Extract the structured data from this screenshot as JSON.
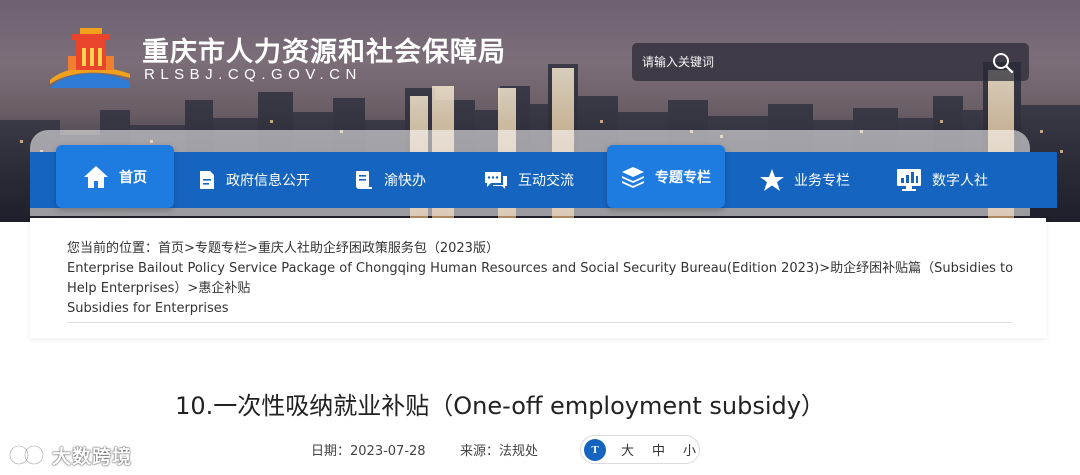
{
  "header": {
    "site_title": "重庆市人力资源和社会保障局",
    "site_domain": "RLSBJ.CQ.GOV.CN"
  },
  "search": {
    "placeholder": "请输入关键词"
  },
  "nav": {
    "items": [
      {
        "label": "首页",
        "icon": "home-icon",
        "active": true
      },
      {
        "label": "政府信息公开",
        "icon": "document-icon",
        "active": false
      },
      {
        "label": "渝快办",
        "icon": "book-icon",
        "active": false
      },
      {
        "label": "互动交流",
        "icon": "chat-icon",
        "active": false
      },
      {
        "label": "专题专栏",
        "icon": "layers-icon",
        "active": true
      },
      {
        "label": "业务专栏",
        "icon": "star-icon",
        "active": false
      },
      {
        "label": "数字人社",
        "icon": "monitor-chart-icon",
        "active": false
      }
    ]
  },
  "breadcrumb": {
    "prefix": "您当前的位置：",
    "items": [
      "首页",
      "专题专栏",
      "重庆人社助企纾困政策服务包（2023版）",
      "Enterprise Bailout Policy Service Package of Chongqing Human Resources and Social Security Bureau(Edition 2023)",
      "助企纾困补贴篇（Subsidies to Help Enterprises）",
      "惠企补贴",
      "Subsidies for Enterprises"
    ],
    "separator": ">"
  },
  "article": {
    "title": "10.一次性吸纳就业补贴（One-off employment subsidy）",
    "date_label": "日期：",
    "date": "2023-07-28",
    "source_label": "来源：",
    "source": "法规处",
    "font_size_icon_text": "T",
    "font_sizes": [
      "大",
      "中",
      "小"
    ]
  },
  "watermark": {
    "text": "大数跨境"
  },
  "colors": {
    "nav_bg": "#1565c0",
    "nav_active": "#1e7be0",
    "title_text": "#ffffff"
  }
}
